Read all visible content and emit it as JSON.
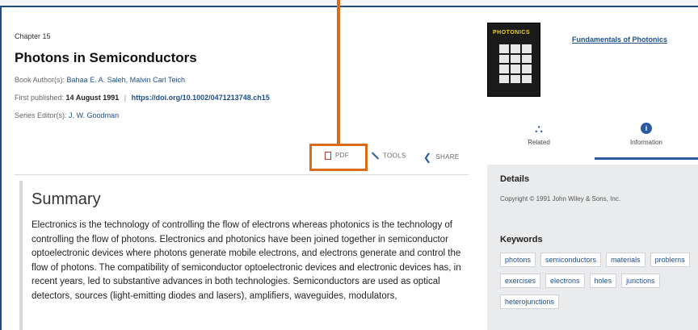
{
  "chapter": {
    "label": "Chapter 15",
    "title": "Photons in Semiconductors",
    "authors_label": "Book Author(s):",
    "authors": [
      "Bahaa E. A. Saleh,",
      "Malvin Carl Teich"
    ],
    "published_label": "First published:",
    "published_date": "14 August 1991",
    "doi": "https://doi.org/10.1002/0471213748.ch15",
    "series_label": "Series Editor(s):",
    "series_editor": "J. W. Goodman"
  },
  "actions": {
    "pdf_label": "PDF",
    "tools_label": "TOOLS",
    "share_label": "SHARE"
  },
  "summary": {
    "heading": "Summary",
    "text": "Electronics is the technology of controlling the flow of electrons whereas photonics is the technology of controlling the flow of photons. Electronics and photonics have been joined together in semiconductor optoelectronic devices where photons generate mobile electrons, and electrons generate and control the flow of photons. The compatibility of semiconductor optoelectronic devices and electronic devices has, in recent years, led to substantive advances in both technologies. Semiconductors are used as optical detectors, sources (light-emitting diodes and lasers), amplifiers, waveguides, modulators,"
  },
  "sidebar": {
    "book_cover_title": "PHOTONICS",
    "book_link": "Fundamentals of Photonics",
    "tabs": [
      {
        "label": "Related",
        "icon": "related-icon"
      },
      {
        "label": "Information",
        "icon": "info-icon"
      }
    ],
    "details_heading": "Details",
    "copyright": "Copyright © 1991 John Wiley & Sons, Inc.",
    "keywords_heading": "Keywords",
    "keywords": [
      "photons",
      "semiconductors",
      "materials",
      "problems",
      "exercises",
      "electrons",
      "holes",
      "junctions",
      "heterojunctions"
    ]
  },
  "colors": {
    "accent_blue": "#1f4f8a",
    "highlight_orange": "#d96b1a"
  }
}
